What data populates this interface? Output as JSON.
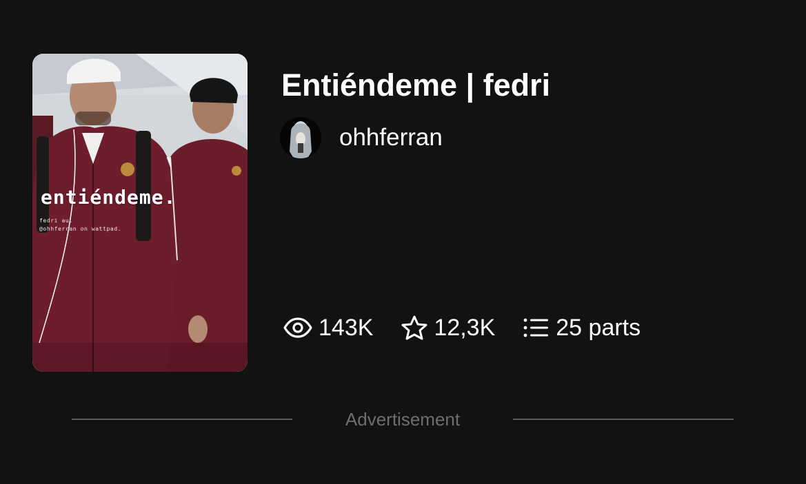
{
  "story": {
    "title": "Entiéndeme | fedri",
    "cover": {
      "title_text": "entiéndeme.",
      "subtitle_line1": "fedri au.",
      "subtitle_line2": "@ohhferran on wattpad."
    }
  },
  "author": {
    "username": "ohhferran"
  },
  "stats": {
    "reads": {
      "icon": "eye-icon",
      "value": "143K"
    },
    "votes": {
      "icon": "star-icon",
      "value": "12,3K"
    },
    "parts": {
      "icon": "list-icon",
      "value": "25 parts"
    }
  },
  "ad": {
    "label": "Advertisement"
  },
  "colors": {
    "background": "#121212",
    "text": "#ffffff",
    "divider": "#5c5c5c",
    "muted_text": "#6e6e6e",
    "jacket": "#6e1d2c"
  }
}
